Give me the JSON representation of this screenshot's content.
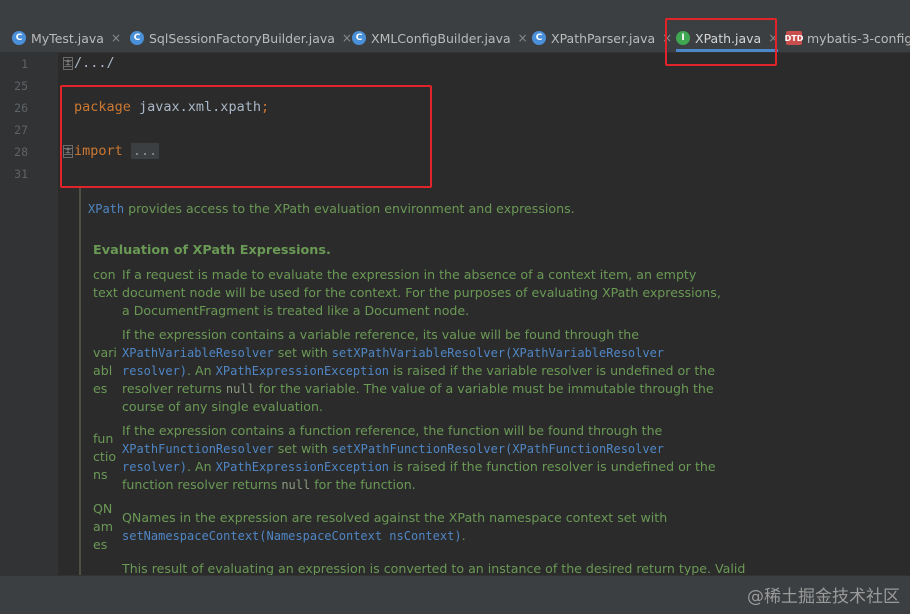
{
  "tabs": [
    {
      "label": "MyTest.java",
      "icon": "c",
      "icon_name": "java-class-icon",
      "active": false
    },
    {
      "label": "SqlSessionFactoryBuilder.java",
      "icon": "c",
      "icon_name": "java-class-icon",
      "active": false
    },
    {
      "label": "XMLConfigBuilder.java",
      "icon": "c",
      "icon_name": "java-class-icon",
      "active": false
    },
    {
      "label": "XPathParser.java",
      "icon": "c",
      "icon_name": "java-class-icon",
      "active": false
    },
    {
      "label": "XPath.java",
      "icon": "I",
      "icon_name": "java-interface-icon",
      "active": true
    },
    {
      "label": "mybatis-3-config.d",
      "icon": "DTD",
      "icon_name": "dtd-file-icon",
      "active": false
    }
  ],
  "close_glyph": "×",
  "line_numbers": [
    "1",
    "25",
    "26",
    "27",
    "28",
    "31"
  ],
  "code": {
    "line1": "/.../",
    "package_kw": "package",
    "package_name": " javax.xml.xpath",
    "package_semi": ";",
    "import_kw": "import",
    "import_folded": "..."
  },
  "doc": {
    "intro_mono": "XPath",
    "intro_text": " provides access to the XPath evaluation environment and expressions.",
    "heading": "Evaluation of XPath Expressions.",
    "rows": [
      {
        "term": "context",
        "text": "If a request is made to evaluate the expression in the absence of a context item, an empty document node will be used for the context. For the purposes of evaluating XPath expressions, a DocumentFragment is treated like a Document node."
      },
      {
        "term": "variables",
        "p1": "If the expression contains a variable reference, its value will be found through the ",
        "m1": "XPathVariableResolver",
        "p2": " set with ",
        "m2": "setXPathVariableResolver(XPathVariableResolver resolver)",
        "p3": ". An ",
        "m3": "XPathExpressionException",
        "p4": " is raised if the variable resolver is undefined or the resolver returns ",
        "m4": "null",
        "p5": " for the variable. The value of a variable must be immutable through the course of any single evaluation."
      },
      {
        "term": "functions",
        "p1": "If the expression contains a function reference, the function will be found through the ",
        "m1": "XPathFunctionResolver",
        "p2": " set with ",
        "m2": "setXPathFunctionResolver(XPathFunctionResolver resolver)",
        "p3": ". An ",
        "m3": "XPathExpressionException",
        "p4": " is raised if the function resolver is undefined or the function resolver returns ",
        "m4": "null",
        "p5": " for the function."
      },
      {
        "term": "QNames",
        "p1": "QNames in the expression are resolved against the XPath namespace context set with ",
        "m1": "setNamespaceContext(NamespaceContext nsContext)",
        "p2": "."
      }
    ],
    "last_line": "This result of evaluating an expression is converted to an instance of the desired return type. Valid"
  },
  "watermark": "@稀土掘金技术社区",
  "colors": {
    "annotation": "#e0242a",
    "keyword": "#cc7832",
    "doc_text": "#6a9955",
    "doc_link": "#4f86c5"
  }
}
